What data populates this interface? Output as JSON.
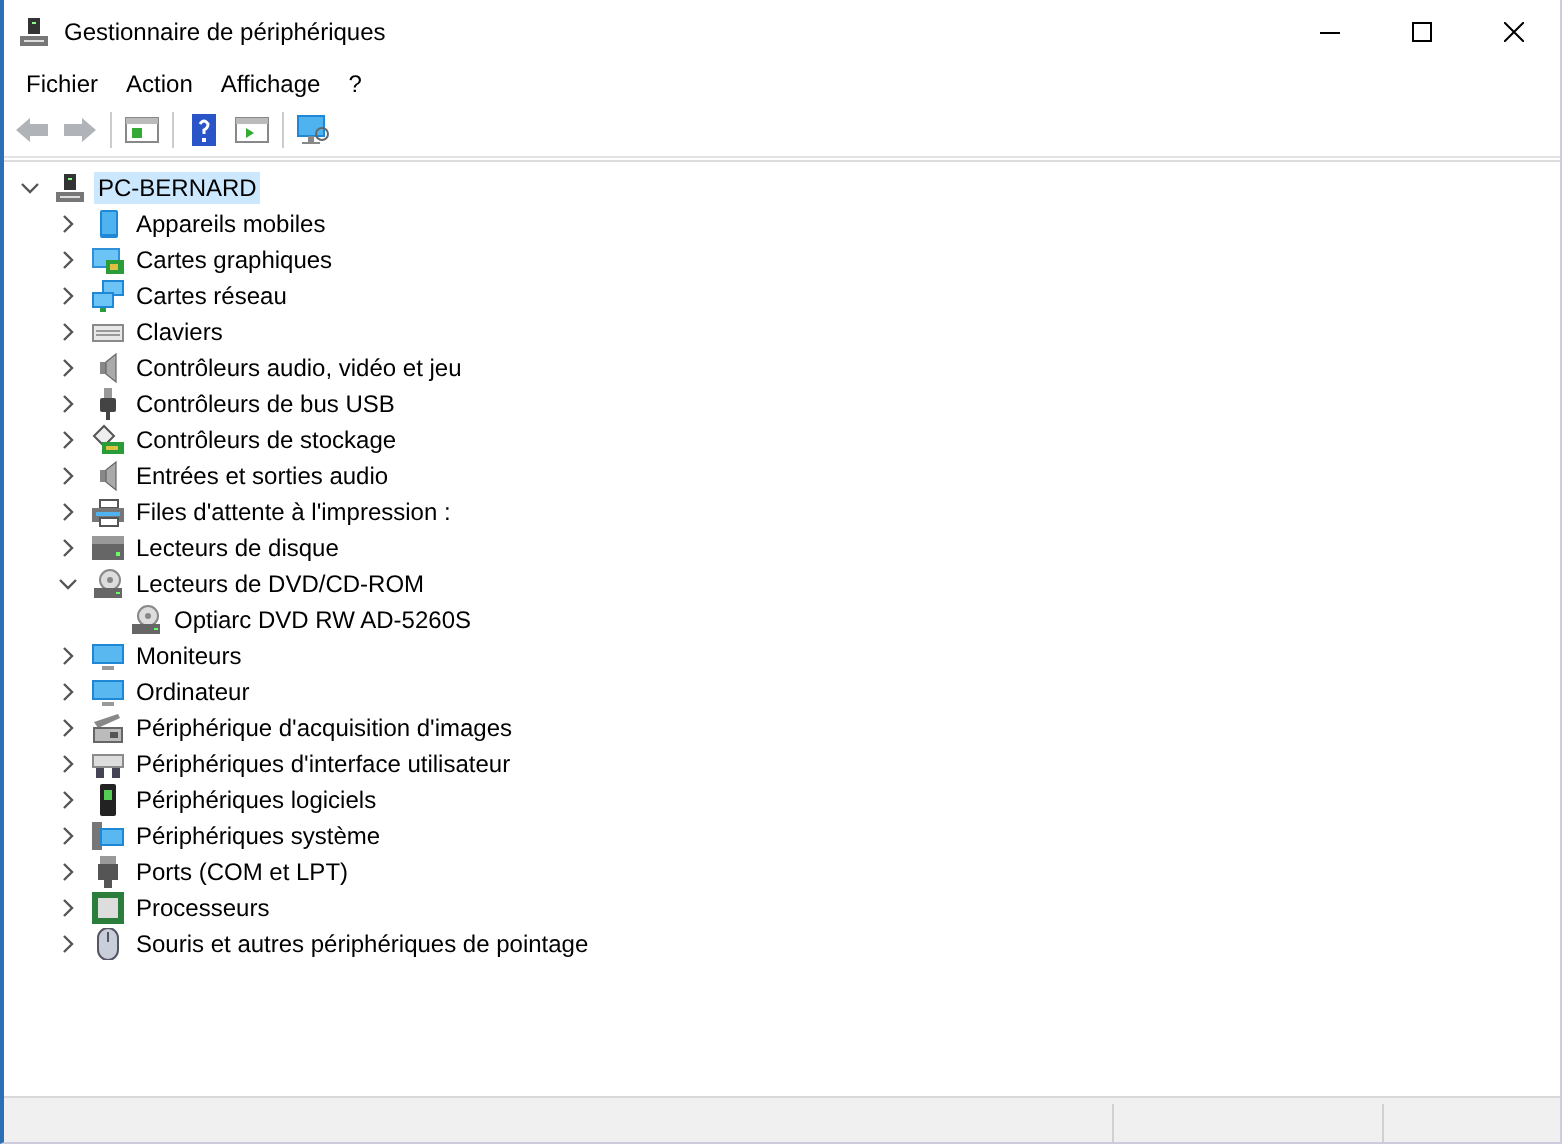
{
  "window": {
    "title": "Gestionnaire de périphériques"
  },
  "menu": [
    "Fichier",
    "Action",
    "Affichage",
    "?"
  ],
  "tree": {
    "label": "PC-BERNARD",
    "expanded": true,
    "selected": true,
    "children": [
      {
        "label": "Appareils mobiles",
        "expanded": false,
        "selected": false
      },
      {
        "label": "Cartes graphiques",
        "expanded": false,
        "selected": false
      },
      {
        "label": "Cartes réseau",
        "expanded": false,
        "selected": false
      },
      {
        "label": "Claviers",
        "expanded": false,
        "selected": false
      },
      {
        "label": "Contrôleurs audio, vidéo et jeu",
        "expanded": false,
        "selected": false
      },
      {
        "label": "Contrôleurs de bus USB",
        "expanded": false,
        "selected": false
      },
      {
        "label": "Contrôleurs de stockage",
        "expanded": false,
        "selected": false
      },
      {
        "label": "Entrées et sorties audio",
        "expanded": false,
        "selected": false
      },
      {
        "label": "Files d'attente à l'impression :",
        "expanded": false,
        "selected": false
      },
      {
        "label": "Lecteurs de disque",
        "expanded": false,
        "selected": false
      },
      {
        "label": "Lecteurs de DVD/CD-ROM",
        "expanded": true,
        "selected": false,
        "children": [
          {
            "label": "Optiarc DVD RW AD-5260S",
            "selected": false
          }
        ]
      },
      {
        "label": "Moniteurs",
        "expanded": false,
        "selected": false
      },
      {
        "label": "Ordinateur",
        "expanded": false,
        "selected": false
      },
      {
        "label": "Périphérique d'acquisition d'images",
        "expanded": false,
        "selected": false
      },
      {
        "label": "Périphériques d'interface utilisateur",
        "expanded": false,
        "selected": false
      },
      {
        "label": "Périphériques logiciels",
        "expanded": false,
        "selected": false
      },
      {
        "label": "Périphériques système",
        "expanded": false,
        "selected": false
      },
      {
        "label": "Ports (COM et LPT)",
        "expanded": false,
        "selected": false
      },
      {
        "label": "Processeurs",
        "expanded": false,
        "selected": false
      },
      {
        "label": "Souris et autres périphériques de pointage",
        "expanded": false,
        "selected": false
      }
    ]
  }
}
